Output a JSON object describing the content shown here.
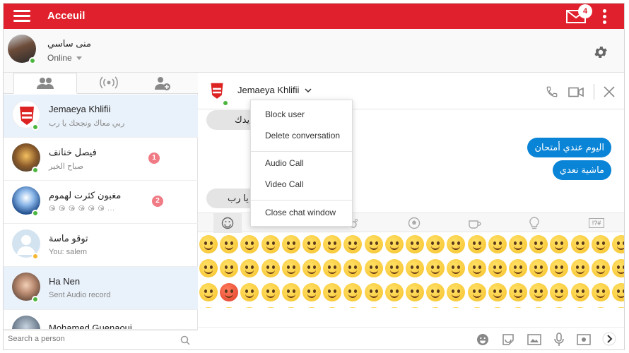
{
  "app": {
    "title": "Acceuil",
    "notification_count": "4"
  },
  "user": {
    "name": "منى ساسي",
    "status": "Online"
  },
  "tabs": [
    {
      "name": "contacts",
      "icon": "people-icon"
    },
    {
      "name": "broadcast",
      "icon": "broadcast-icon"
    },
    {
      "name": "add-contact",
      "icon": "add-user-icon"
    }
  ],
  "conversations": [
    {
      "name": "Jemaeya Khlifii",
      "last": "ربي معاك ونجحك يا رب",
      "unread": "",
      "status": "green"
    },
    {
      "name": "فيصل خنانف",
      "last": "صباح الخير",
      "unread": "1",
      "status": "green"
    },
    {
      "name": "مغبون كثرت لهموم",
      "last": "😘 😘 😘 😘 😘 😘 ...",
      "unread": "2",
      "status": "green"
    },
    {
      "name": "توقو ماسة",
      "last": "You: salem",
      "unread": "",
      "status": "yellow"
    },
    {
      "name": "Ha Nen",
      "last": "Sent Audio record",
      "unread": "",
      "status": "green"
    },
    {
      "name": "Mohamed Guenaoui",
      "last": "",
      "unread": "",
      "status": "green"
    }
  ],
  "search": {
    "placeholder": "Search a person"
  },
  "chat": {
    "contact": "Jemaeya Khlifii",
    "messages": [
      {
        "dir": "in",
        "text": "و اجديدك"
      },
      {
        "dir": "out",
        "text": "اليوم عندي أمتحان"
      },
      {
        "dir": "out",
        "text": "ماشية نعدي"
      },
      {
        "dir": "in",
        "text": "حك يا رب"
      }
    ]
  },
  "menu": {
    "items": [
      "Block user",
      "Delete conversation",
      "Audio Call",
      "Video Call",
      "Close chat window"
    ]
  },
  "emoji_tabs": [
    "smileys",
    "animals",
    "food",
    "sports",
    "travel",
    "objects",
    "symbols"
  ],
  "emoji_symbols_label": "!?#",
  "colors": {
    "brand": "#e0212d",
    "outgoing": "#0a84d6",
    "online": "#4cb53f",
    "away": "#f5b731"
  }
}
